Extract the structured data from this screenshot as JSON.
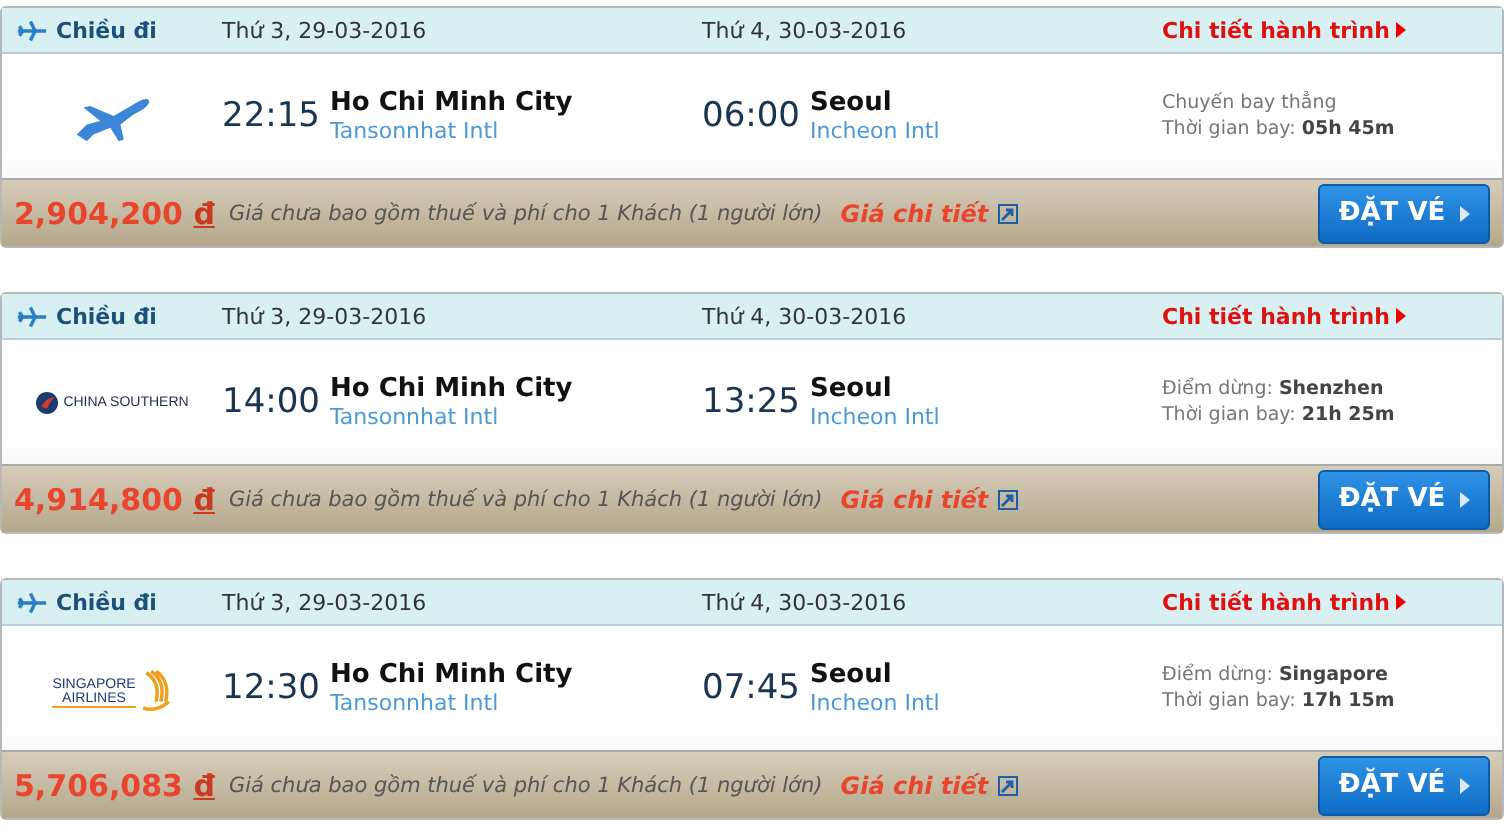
{
  "flights": [
    {
      "direction": "Chiều đi",
      "depart_date": "Thứ 3, 29-03-2016",
      "arrive_date": "Thứ 4, 30-03-2016",
      "details_link": "Chi tiết hành trình",
      "logo": {
        "kind": "plane"
      },
      "depart": {
        "time": "22:15",
        "city": "Ho Chi Minh City",
        "airport": "Tansonnhat Intl"
      },
      "arrive": {
        "time": "06:00",
        "city": "Seoul",
        "airport": "Incheon Intl"
      },
      "stop": {
        "kind": "direct",
        "text": "Chuyến bay thẳng"
      },
      "duration": {
        "label": "Thời gian bay:",
        "value": "05h 45m"
      },
      "price": "2,904,200",
      "currency": "đ",
      "price_note": "Giá chưa bao gồm thuế và phí cho 1 Khách (1 người lớn)",
      "price_link": "Giá chi tiết",
      "book_button": "ĐẶT VÉ"
    },
    {
      "direction": "Chiều đi",
      "depart_date": "Thứ 3, 29-03-2016",
      "arrive_date": "Thứ 4, 30-03-2016",
      "details_link": "Chi tiết hành trình",
      "logo": {
        "kind": "china",
        "text": "CHINA SOUTHERN"
      },
      "depart": {
        "time": "14:00",
        "city": "Ho Chi Minh City",
        "airport": "Tansonnhat Intl"
      },
      "arrive": {
        "time": "13:25",
        "city": "Seoul",
        "airport": "Incheon Intl"
      },
      "stop": {
        "kind": "stop",
        "label": "Điểm dừng:",
        "value": "Shenzhen"
      },
      "duration": {
        "label": "Thời gian bay:",
        "value": "21h 25m"
      },
      "price": "4,914,800",
      "currency": "đ",
      "price_note": "Giá chưa bao gồm thuế và phí cho 1 Khách (1 người lớn)",
      "price_link": "Giá chi tiết",
      "book_button": "ĐẶT VÉ"
    },
    {
      "direction": "Chiều đi",
      "depart_date": "Thứ 3, 29-03-2016",
      "arrive_date": "Thứ 4, 30-03-2016",
      "details_link": "Chi tiết hành trình",
      "logo": {
        "kind": "singapore",
        "lines": [
          "SINGAPORE",
          "AIRLINES"
        ]
      },
      "depart": {
        "time": "12:30",
        "city": "Ho Chi Minh City",
        "airport": "Tansonnhat Intl"
      },
      "arrive": {
        "time": "07:45",
        "city": "Seoul",
        "airport": "Incheon Intl"
      },
      "stop": {
        "kind": "stop",
        "label": "Điểm dừng:",
        "value": "Singapore"
      },
      "duration": {
        "label": "Thời gian bay:",
        "value": "17h 15m"
      },
      "price": "5,706,083",
      "currency": "đ",
      "price_note": "Giá chưa bao gồm thuế và phí cho 1 Khách (1 người lớn)",
      "price_link": "Giá chi tiết",
      "book_button": "ĐẶT VÉ"
    }
  ]
}
